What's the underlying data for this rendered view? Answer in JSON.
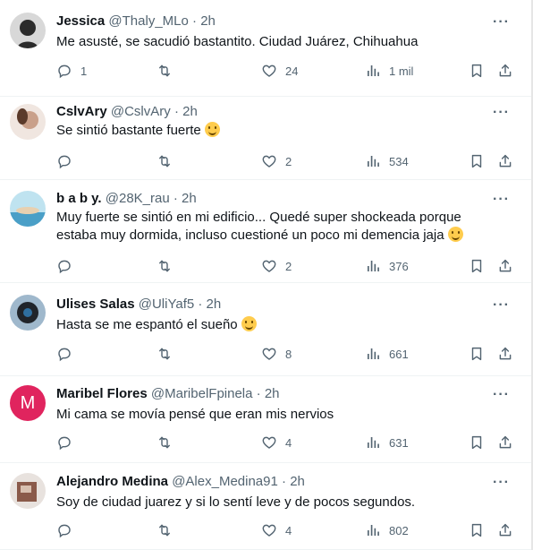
{
  "tweets": [
    {
      "name": "Jessica",
      "handle": "@Thaly_MLo",
      "sep": "·",
      "time": "2h",
      "text": "Me asusté, se sacudió bastantito. Ciudad Juárez, Chihuahua",
      "emoji": "",
      "replies": "1",
      "likes": "24",
      "views": "1 mil",
      "avatar_color": "#2b2b2b"
    },
    {
      "name": "CslvAry",
      "handle": "@CslvAry",
      "sep": "·",
      "time": "2h",
      "text": "Se sintió bastante fuerte",
      "emoji": "😢",
      "replies": "",
      "likes": "2",
      "views": "534",
      "avatar_color": "#c9a08a"
    },
    {
      "name": "b a b y.",
      "handle": "@28K_rau",
      "sep": "·",
      "time": "2h",
      "text": "Muy fuerte se sintió en mi edificio... Quedé super shockeada porque estaba muy dormida, incluso cuestioné un poco mi demencia jaja",
      "emoji": "😂",
      "replies": "",
      "likes": "2",
      "views": "376",
      "avatar_color": "#4a9fc7"
    },
    {
      "name": "Ulises Salas",
      "handle": "@UliYaf5",
      "sep": "·",
      "time": "2h",
      "text": "Hasta se me espantó el sueño",
      "emoji": "😅",
      "replies": "",
      "likes": "8",
      "views": "661",
      "avatar_color": "#20242a"
    },
    {
      "name": "Maribel Flores",
      "handle": "@MaribelFpinela",
      "sep": "·",
      "time": "2h",
      "text": "Mi cama se movía pensé que eran mis nervios",
      "emoji": "",
      "replies": "",
      "likes": "4",
      "views": "631",
      "avatar_letter": "M",
      "avatar_color": "#e0245e"
    },
    {
      "name": "Alejandro Medina",
      "handle": "@Alex_Medina91",
      "sep": "·",
      "time": "2h",
      "text": "Soy de ciudad juarez y si lo sentí leve y de pocos segundos.",
      "emoji": "",
      "replies": "",
      "likes": "4",
      "views": "802",
      "avatar_color": "#8a5a4a"
    }
  ],
  "icons": {
    "reply": "reply-icon",
    "retweet": "retweet-icon",
    "like": "heart-icon",
    "views": "views-icon",
    "bookmark": "bookmark-icon",
    "share": "share-icon",
    "more": "more-icon"
  },
  "more_glyph": "···"
}
